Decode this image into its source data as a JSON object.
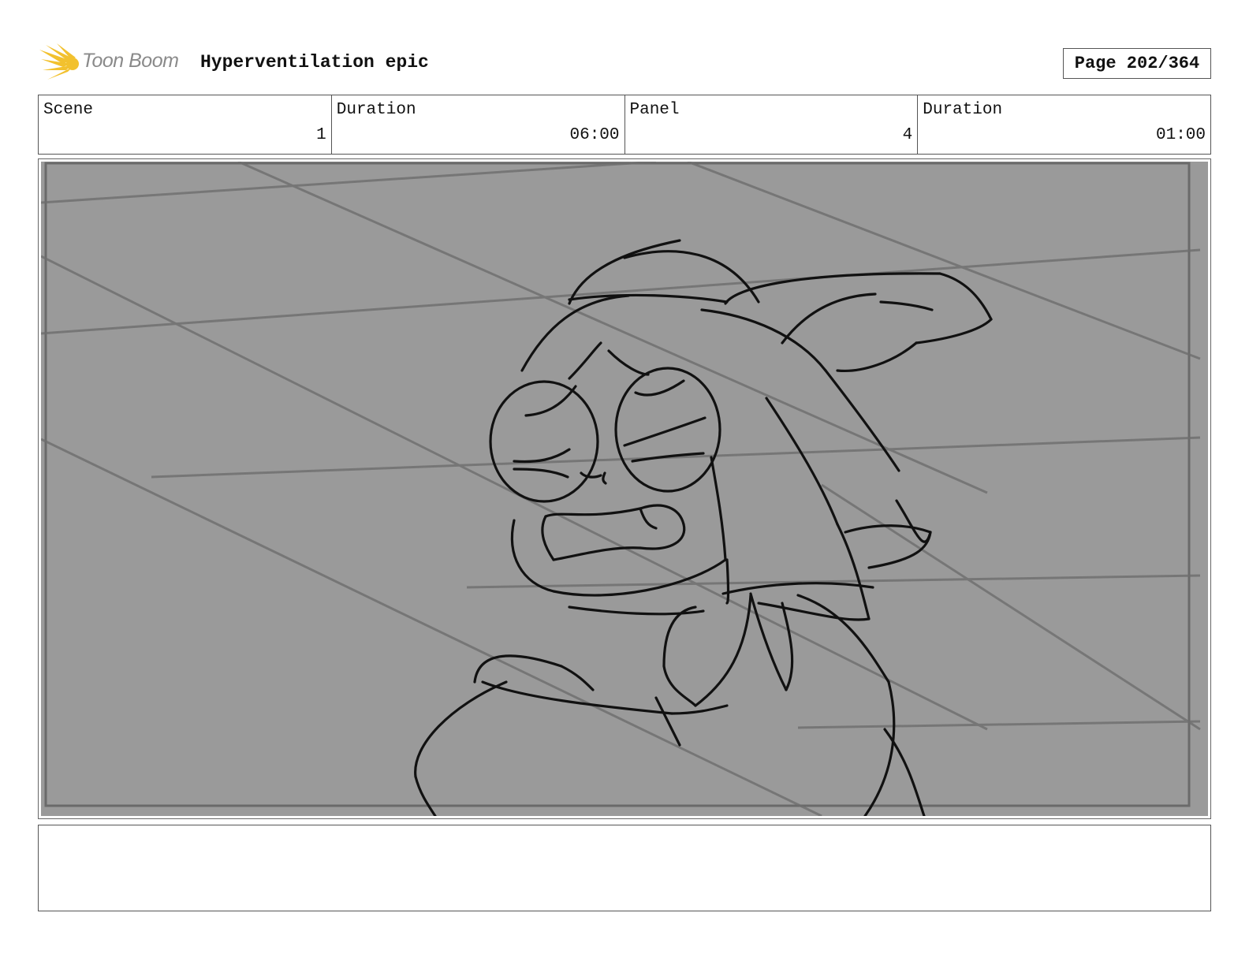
{
  "header": {
    "logo_text": "Toon Boom",
    "title": "Hyperventilation epic",
    "page": "Page 202/364"
  },
  "info": {
    "scene_label": "Scene",
    "scene_value": "1",
    "scene_duration_label": "Duration",
    "scene_duration_value": "06:00",
    "panel_label": "Panel",
    "panel_value": "4",
    "panel_duration_label": "Duration",
    "panel_duration_value": "01:00"
  },
  "panel": {
    "background": "#9a9a9a",
    "sketch_color": "#111111",
    "image": "storyboard-sketch: worried character with round glasses and cap, grimacing"
  },
  "notes": {
    "text": ""
  },
  "colors": {
    "logo_yellow": "#f2c12e",
    "logo_text": "#8a8a8a"
  }
}
